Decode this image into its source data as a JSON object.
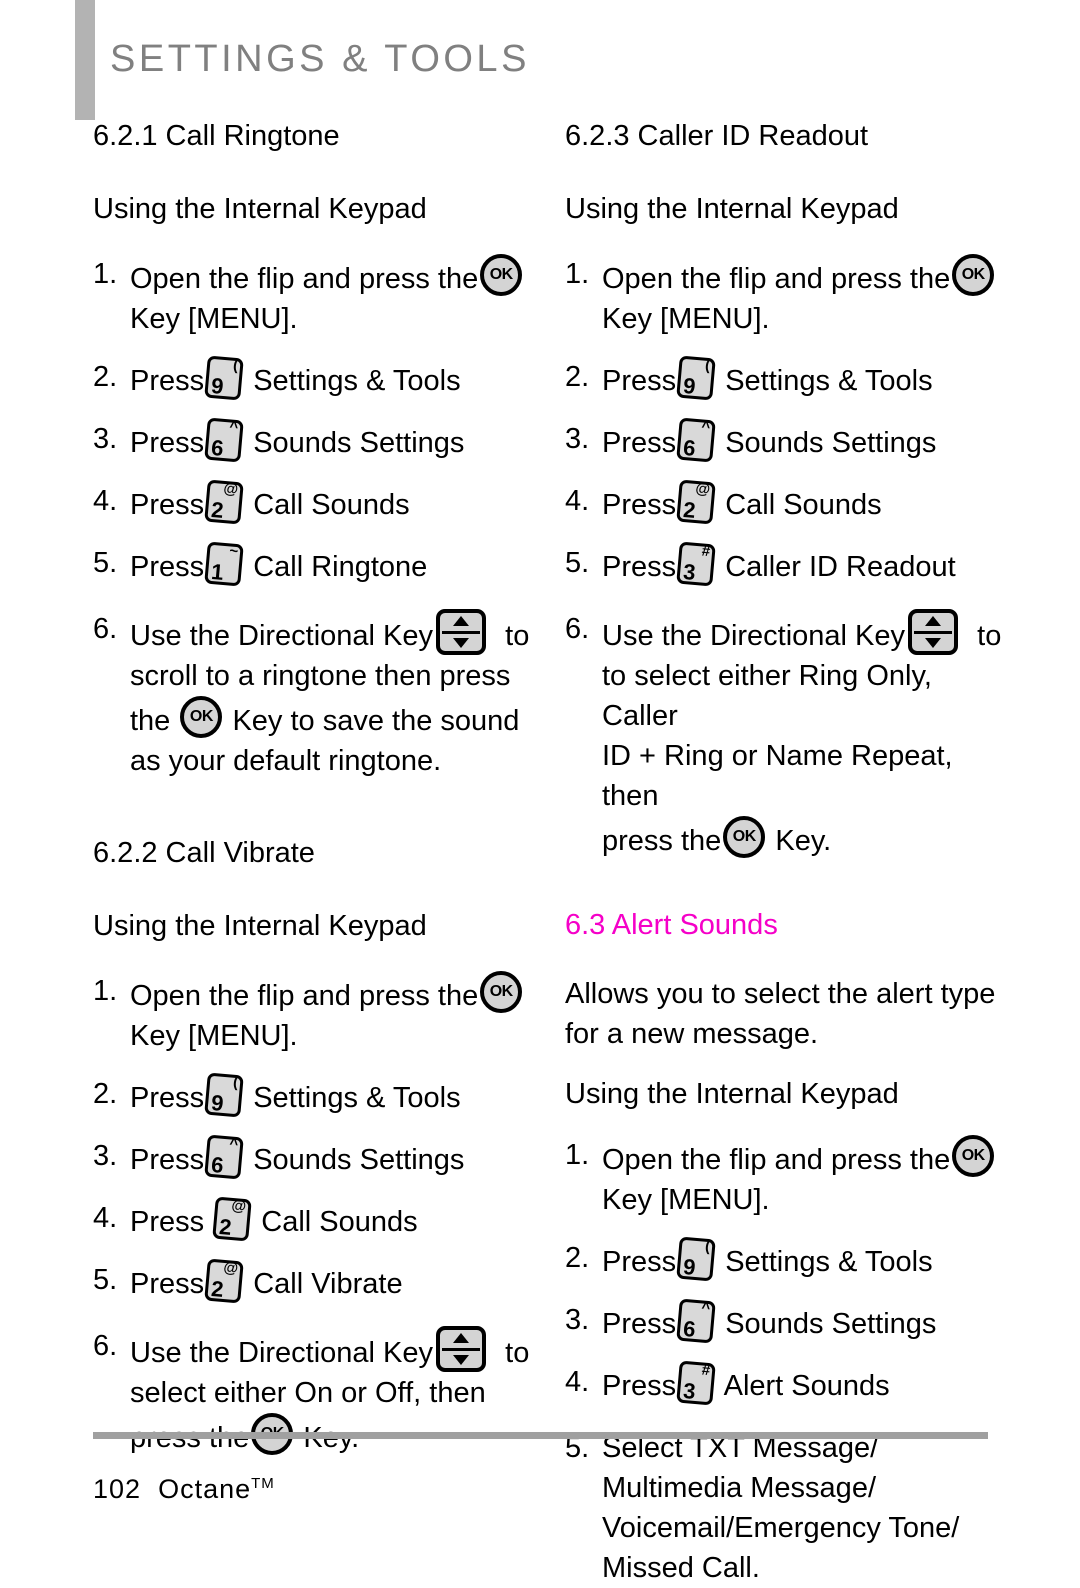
{
  "header": {
    "title": "SETTINGS & TOOLS"
  },
  "footer": {
    "page_number": "102",
    "product": "Octane",
    "trademark": "TM"
  },
  "common": {
    "subhead_internal_keypad": "Using the Internal Keypad",
    "press_label": "Press",
    "select_label": "Select",
    "use_directional_prefix": "Use the Directional Key",
    "use_directional_suffix": "to",
    "ok_key_label": "OK",
    "step_open_flip_a": "Open the flip and press the",
    "step_open_flip_b": "Key [MENU].",
    "label_settings_tools": "Settings & Tools",
    "label_sounds_settings": "Sounds Settings",
    "label_call_sounds": "Call Sounds"
  },
  "left_column": {
    "sections": [
      {
        "number": "6.2.1",
        "title": "Call Ringtone",
        "heading": "6.2.1 Call Ringtone",
        "subhead": "Using the Internal Keypad",
        "steps": [
          {
            "num": "1.",
            "type": "flip",
            "text_before": "Open the flip and press the",
            "key": {
              "kind": "ok",
              "label": "OK"
            },
            "text_after": "Key [MENU]."
          },
          {
            "num": "2.",
            "type": "press",
            "text_before": "Press",
            "key": {
              "kind": "num",
              "digit": "9",
              "sup": "("
            },
            "text_after": "Settings & Tools"
          },
          {
            "num": "3.",
            "type": "press",
            "text_before": "Press",
            "key": {
              "kind": "num",
              "digit": "6",
              "sup": "^"
            },
            "text_after": "Sounds Settings"
          },
          {
            "num": "4.",
            "type": "press",
            "text_before": "Press",
            "key": {
              "kind": "num",
              "digit": "2",
              "sup": "@"
            },
            "text_after": "Call Sounds"
          },
          {
            "num": "5.",
            "type": "press",
            "text_before": "Press",
            "key": {
              "kind": "num",
              "digit": "1",
              "sup": "~"
            },
            "text_after": "Call Ringtone"
          },
          {
            "num": "6.",
            "type": "directional",
            "text_before": "Use the Directional Key",
            "key": {
              "kind": "dir"
            },
            "text_mid": "to",
            "text_after_1": "scroll to a ringtone then press",
            "text_after_2a": "the",
            "inline_key": {
              "kind": "ok",
              "label": "OK"
            },
            "text_after_2b": "Key to save the sound",
            "text_after_3": "as your default ringtone."
          }
        ]
      },
      {
        "number": "6.2.2",
        "title": "Call Vibrate",
        "heading": "6.2.2 Call Vibrate",
        "subhead": "Using the Internal Keypad",
        "steps": [
          {
            "num": "1.",
            "type": "flip",
            "text_before": "Open the flip and press the",
            "key": {
              "kind": "ok",
              "label": "OK"
            },
            "text_after": "Key [MENU]."
          },
          {
            "num": "2.",
            "type": "press",
            "text_before": "Press",
            "key": {
              "kind": "num",
              "digit": "9",
              "sup": "("
            },
            "text_after": "Settings & Tools"
          },
          {
            "num": "3.",
            "type": "press",
            "text_before": "Press",
            "key": {
              "kind": "num",
              "digit": "6",
              "sup": "^"
            },
            "text_after": "Sounds Settings"
          },
          {
            "num": "4.",
            "type": "press",
            "text_before": "Press",
            "key": {
              "kind": "num",
              "digit": "2",
              "sup": "@"
            },
            "text_after": "Call Sounds"
          },
          {
            "num": "5.",
            "type": "press",
            "text_before": "Press",
            "key": {
              "kind": "num",
              "digit": "2",
              "sup": "@"
            },
            "text_after": "Call Vibrate"
          },
          {
            "num": "6.",
            "type": "directional",
            "text_before": "Use the Directional Key",
            "key": {
              "kind": "dir"
            },
            "text_mid": "to",
            "text_after_1": "select either On or Off, then",
            "text_after_2a": "press the",
            "inline_key": {
              "kind": "ok",
              "label": "OK"
            },
            "text_after_2b": "Key."
          }
        ]
      }
    ]
  },
  "right_column": {
    "sections": [
      {
        "number": "6.2.3",
        "title": "Caller ID Readout",
        "heading": "6.2.3 Caller ID Readout",
        "subhead": "Using the Internal Keypad",
        "steps": [
          {
            "num": "1.",
            "type": "flip",
            "text_before": "Open the flip and press the",
            "key": {
              "kind": "ok",
              "label": "OK"
            },
            "text_after": "Key [MENU]."
          },
          {
            "num": "2.",
            "type": "press",
            "text_before": "Press",
            "key": {
              "kind": "num",
              "digit": "9",
              "sup": "("
            },
            "text_after": "Settings & Tools"
          },
          {
            "num": "3.",
            "type": "press",
            "text_before": "Press",
            "key": {
              "kind": "num",
              "digit": "6",
              "sup": "^"
            },
            "text_after": "Sounds Settings"
          },
          {
            "num": "4.",
            "type": "press",
            "text_before": "Press",
            "key": {
              "kind": "num",
              "digit": "2",
              "sup": "@"
            },
            "text_after": "Call Sounds"
          },
          {
            "num": "5.",
            "type": "press",
            "text_before": "Press",
            "key": {
              "kind": "num",
              "digit": "3",
              "sup": "#"
            },
            "text_after": "Caller ID Readout"
          },
          {
            "num": "6.",
            "type": "directional",
            "text_before": "Use the Directional Key",
            "key": {
              "kind": "dir"
            },
            "text_mid": "to",
            "text_after_1": "to select either Ring Only, Caller",
            "text_after_2": "ID + Ring or Name Repeat, then",
            "text_after_3a": "press the",
            "inline_key": {
              "kind": "ok",
              "label": "OK"
            },
            "text_after_3b": "Key."
          }
        ]
      },
      {
        "number": "6.3",
        "title": "Alert Sounds",
        "heading": "6.3 Alert Sounds",
        "heading_color": "#f500c8",
        "description_1": "Allows you to select the alert type",
        "description_2": "for a new message.",
        "subhead": "Using the Internal Keypad",
        "steps": [
          {
            "num": "1.",
            "type": "flip",
            "text_before": "Open the flip and press the",
            "key": {
              "kind": "ok",
              "label": "OK"
            },
            "text_after": "Key [MENU]."
          },
          {
            "num": "2.",
            "type": "press",
            "text_before": "Press",
            "key": {
              "kind": "num",
              "digit": "9",
              "sup": "("
            },
            "text_after": "Settings & Tools"
          },
          {
            "num": "3.",
            "type": "press",
            "text_before": "Press",
            "key": {
              "kind": "num",
              "digit": "6",
              "sup": "^"
            },
            "text_after": "Sounds Settings"
          },
          {
            "num": "4.",
            "type": "press",
            "text_before": "Press",
            "key": {
              "kind": "num",
              "digit": "3",
              "sup": "#"
            },
            "text_after": "Alert Sounds"
          },
          {
            "num": "5.",
            "type": "select",
            "text_before": "Select TXT Message/",
            "line_2": "Multimedia Message/",
            "line_3": "Voicemail/Emergency Tone/",
            "line_4": "Missed Call."
          }
        ]
      }
    ]
  },
  "colors": {
    "header_gray": "#808080",
    "header_bar_gray": "#b3b3b3",
    "accent_magenta": "#f500c8",
    "key_fill": "#d9d9d9",
    "footer_rule": "#a0a0a0"
  }
}
